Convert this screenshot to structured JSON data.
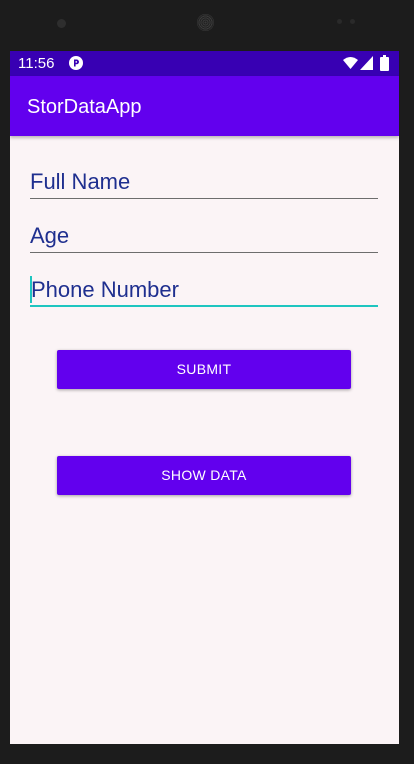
{
  "status_bar": {
    "time": "11:56",
    "icons": [
      "app-notification-icon",
      "wifi-icon",
      "signal-icon",
      "battery-icon"
    ]
  },
  "app_bar": {
    "title": "StorDataApp"
  },
  "form": {
    "full_name": {
      "value": "",
      "placeholder": "Full Name"
    },
    "age": {
      "value": "",
      "placeholder": "Age"
    },
    "phone_number": {
      "value": "",
      "placeholder": "Phone Number",
      "focused": true
    }
  },
  "buttons": {
    "submit_label": "SUBMIT",
    "show_data_label": "SHOW DATA"
  },
  "colors": {
    "status_bar": "#3800b3",
    "primary": "#6200ee",
    "accent": "#1ec5c0",
    "hint_text": "#1f2f8f",
    "background": "#fbf4f6"
  }
}
